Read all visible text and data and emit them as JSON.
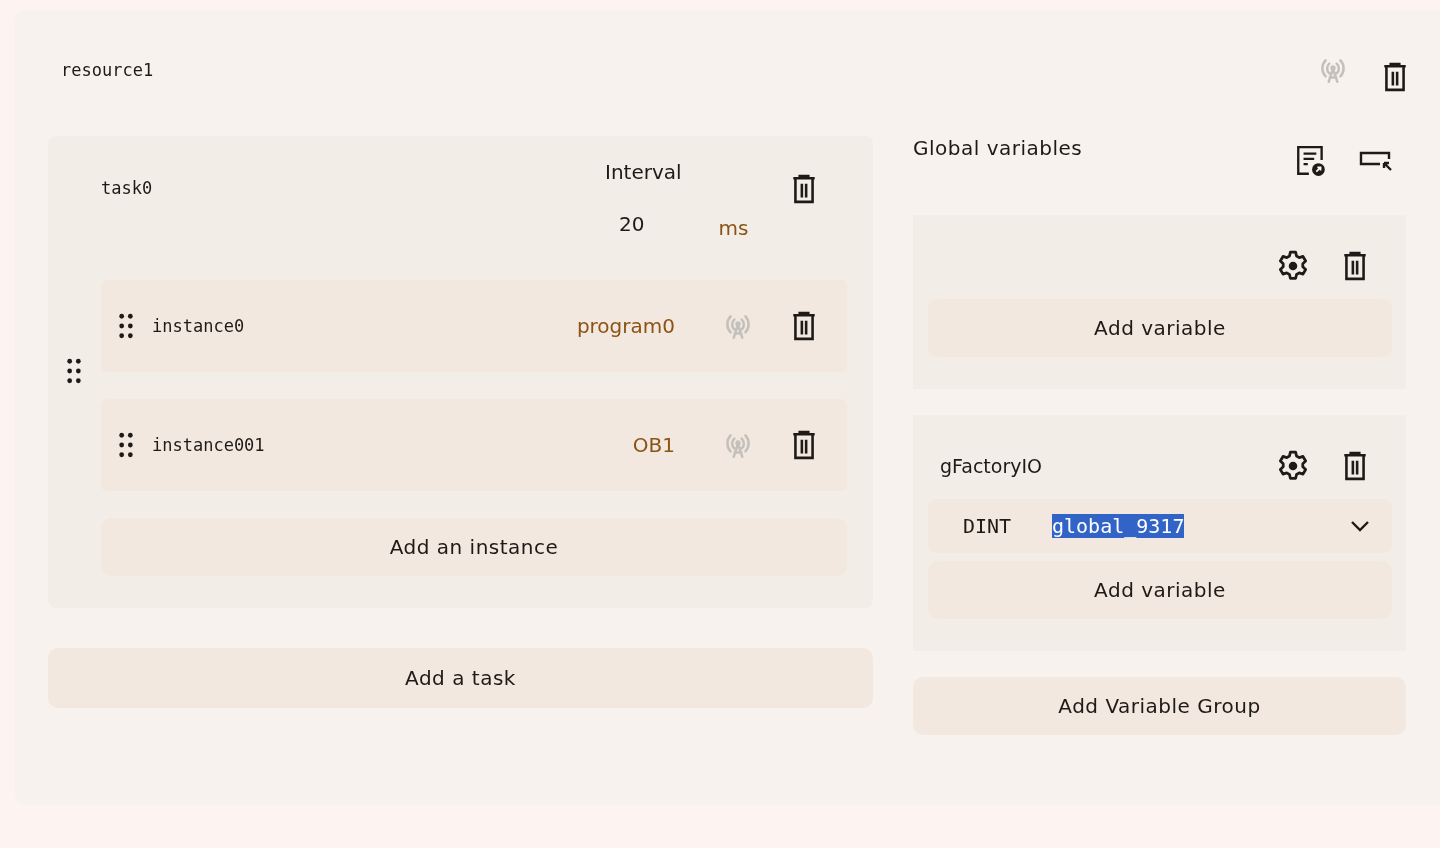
{
  "resource": {
    "name": "resource1",
    "monitoring": false
  },
  "tasks": [
    {
      "name": "task0",
      "interval_label": "Interval",
      "interval": "20",
      "unit": "ms",
      "instances": [
        {
          "name": "instance0",
          "program": "program0",
          "monitoring": false
        },
        {
          "name": "instance001",
          "program": "OB1",
          "monitoring": false
        }
      ],
      "add_instance": "Add an instance"
    }
  ],
  "add_task": "Add a task",
  "globals": {
    "title": "Global variables",
    "groups": [
      {
        "add_variable": "Add variable"
      },
      {
        "name": "gFactoryIO",
        "variables": [
          {
            "type": "DINT",
            "name": "global_9317",
            "text_selected": true
          }
        ],
        "add_variable": "Add variable"
      }
    ],
    "add_group": "Add Variable Group"
  }
}
